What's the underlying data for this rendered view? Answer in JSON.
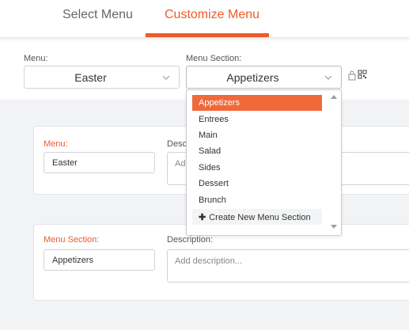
{
  "tabs": {
    "select_menu": "Select Menu",
    "customize_menu": "Customize Menu",
    "active": "customize_menu"
  },
  "selectors": {
    "menu_label": "Menu:",
    "menu_value": "Easter",
    "section_label": "Menu Section:",
    "section_value": "Appetizers",
    "icons": [
      "lock-icon",
      "qr-code-icon"
    ]
  },
  "menu_card": {
    "menu_label": "Menu:",
    "menu_value": "Easter",
    "description_label": "Desc",
    "description_placeholder": "Ad"
  },
  "section_card": {
    "section_label": "Menu Section:",
    "section_value": "Appetizers",
    "description_label": "Description:",
    "description_placeholder": "Add description..."
  },
  "dropdown": {
    "items": [
      "Appetizers",
      "Entrees",
      "Main",
      "Salad",
      "Sides",
      "Dessert",
      "Brunch"
    ],
    "selected": "Appetizers",
    "create_label": "Create New Menu Section"
  },
  "colors": {
    "accent": "#f05a28",
    "highlight": "#f0693a"
  }
}
